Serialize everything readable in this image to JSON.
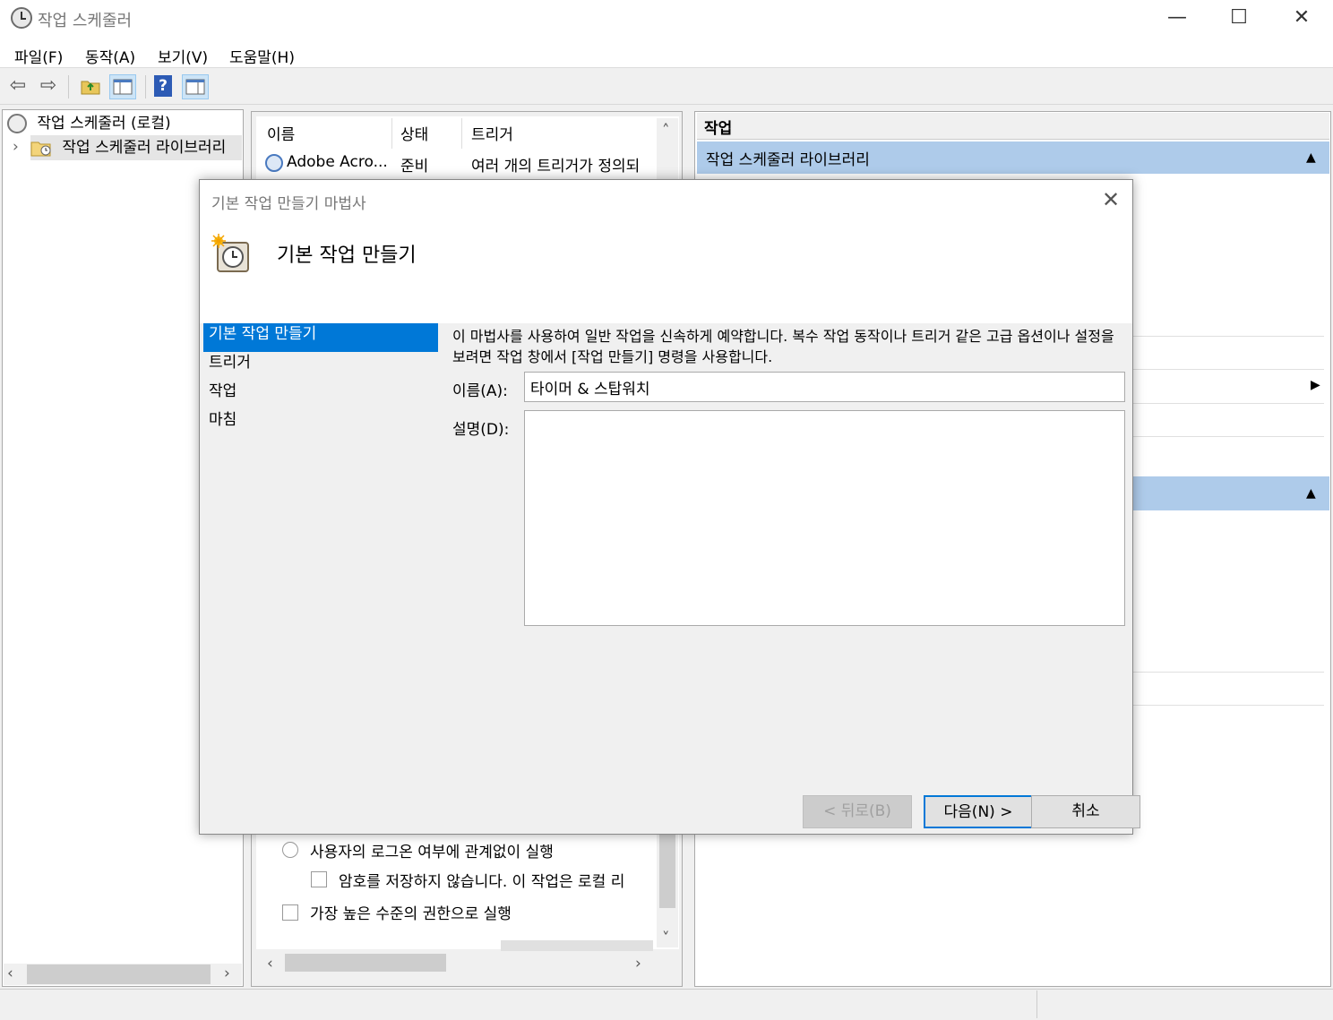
{
  "window": {
    "title": "작업 스케줄러",
    "minimize": "—",
    "maximize": "☐",
    "close": "✕"
  },
  "menu": {
    "file": "파일(F)",
    "action": "동작(A)",
    "view": "보기(V)",
    "help": "도움말(H)"
  },
  "toolbar": {
    "back": "⇦",
    "forward": "⇨",
    "help": "?"
  },
  "tree": {
    "root": "작업 스케줄러 (로컬)",
    "library": "작업 스케줄러 라이브러리",
    "expand_glyph": "›",
    "scroll_left": "‹",
    "scroll_right": "›"
  },
  "task_list": {
    "columns": [
      "이름",
      "상태",
      "트리거"
    ],
    "rows": [
      {
        "name": "Adobe Acro...",
        "status": "준비",
        "trigger": "여러 개의 트리거가 정의되"
      }
    ],
    "scroll_up": "˄",
    "scroll_down": "˅",
    "scroll_left": "‹",
    "scroll_right": "›"
  },
  "general_tab": {
    "run_regardless": "사용자의 로그온 여부에 관계없이 실행",
    "no_store_password": "암호를 저장하지 않습니다. 이 작업은 로컬 리",
    "highest_privileges": "가장 높은 수준의 권한으로 실행"
  },
  "actions": {
    "header": "작업",
    "library_section": "작업 스케줄러 라이브러리",
    "collapse_glyph": "▲",
    "submenu_glyph": "▶"
  },
  "dialog": {
    "title": "기본 작업 만들기 마법사",
    "close": "✕",
    "heading": "기본 작업 만들기",
    "steps": [
      "기본 작업 만들기",
      "트리거",
      "작업",
      "마침"
    ],
    "description": "이 마법사를 사용하여 일반 작업을 신속하게 예약합니다. 복수 작업 동작이나 트리거 같은 고급 옵션이나 설정을 보려면 작업 창에서 [작업 만들기] 명령을 사용합니다.",
    "name_label": "이름(A):",
    "name_value": "타이머 & 스탑워치",
    "desc_label": "설명(D):",
    "desc_value": "",
    "back_button": "< 뒤로(B)",
    "next_button": "다음(N) >",
    "cancel_button": "취소"
  },
  "colors": {
    "selection": "#0078d7",
    "section_header": "#aecbea"
  }
}
